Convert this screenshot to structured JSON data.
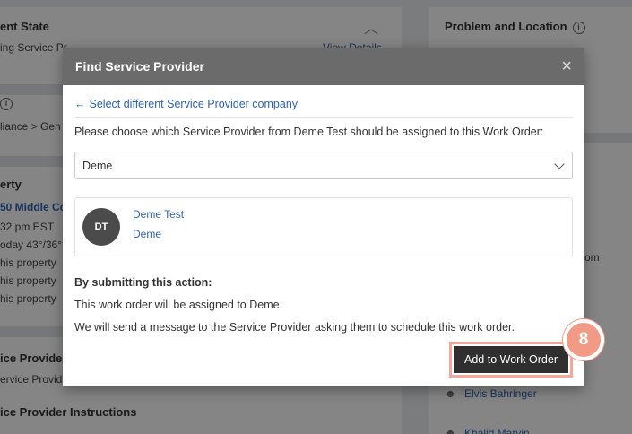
{
  "background": {
    "left": {
      "current_state_title": "ent State",
      "current_state_text": "ing Service Pr",
      "view_details": "View Details",
      "breadcrumb": "liance  >  Gen",
      "property_title": "erty",
      "property_address": "50 Middle Co",
      "time": "32 pm EST",
      "weather": "oday 43°/36°",
      "property_lines": [
        "his property",
        "his property",
        "his property"
      ],
      "service_provider_title": "ice Provider",
      "service_provider_text": "ervice Provid",
      "instructions_title": "ice Provider Instructions"
    },
    "right": {
      "problem_title": "Problem and Location",
      "partial_text": "om",
      "person_name": "Elvis Bahringer",
      "person_name_2": "Khalid Marvin"
    }
  },
  "modal": {
    "title": "Find Service Provider",
    "close": "×",
    "back_link": "Select different Service Provider company",
    "prompt": "Please choose which Service Provider from Deme Test should be assigned to this Work Order:",
    "select_value": "Deme",
    "provider": {
      "initials": "DT",
      "company": "Deme Test",
      "name": "Deme"
    },
    "submit_title": "By submitting this action:",
    "submit_lines": [
      "This work order will be assigned to Deme.",
      "We will send a message to the Service Provider asking them to schedule this work order."
    ],
    "submit_button": "Add to Work Order"
  },
  "step_badge": "8"
}
